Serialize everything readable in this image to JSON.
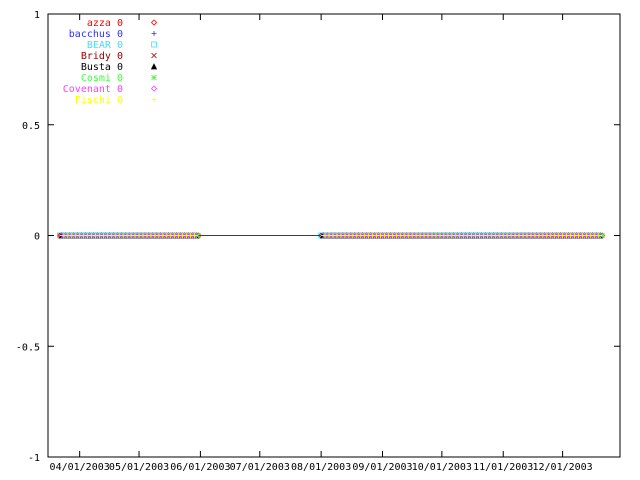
{
  "chart_data": {
    "type": "line",
    "title": "",
    "xlabel": "",
    "ylabel": "",
    "ylim": [
      -1,
      1
    ],
    "xlim": [
      "2003-03-16",
      "2003-12-30"
    ],
    "grid": false,
    "legend_position": "top-left",
    "y_ticks": [
      {
        "value": 1,
        "label": "1"
      },
      {
        "value": 0.5,
        "label": "0.5"
      },
      {
        "value": 0,
        "label": "0"
      },
      {
        "value": -0.5,
        "label": "-0.5"
      },
      {
        "value": -1,
        "label": "-1"
      }
    ],
    "x_ticks": [
      {
        "value": "2003-04-01",
        "label": "04/01/2003"
      },
      {
        "value": "2003-05-01",
        "label": "05/01/2003"
      },
      {
        "value": "2003-06-01",
        "label": "06/01/2003"
      },
      {
        "value": "2003-07-01",
        "label": "07/01/2003"
      },
      {
        "value": "2003-08-01",
        "label": "08/01/2003"
      },
      {
        "value": "2003-09-01",
        "label": "09/01/2003"
      },
      {
        "value": "2003-10-01",
        "label": "10/01/2003"
      },
      {
        "value": "2003-11-01",
        "label": "11/01/2003"
      },
      {
        "value": "2003-12-01",
        "label": "12/01/2003"
      }
    ],
    "series": [
      {
        "name": "azza",
        "legend_value": "0",
        "color": "#ff0000",
        "marker": "diamond",
        "ranges": [
          [
            "2003-03-22",
            "2003-05-31"
          ],
          [
            "2003-08-01",
            "2003-12-21"
          ]
        ],
        "value": 0
      },
      {
        "name": "bacchus",
        "legend_value": "0",
        "color": "#3030ff",
        "marker": "plus",
        "ranges": [
          [
            "2003-03-22",
            "2003-05-31"
          ],
          [
            "2003-08-01",
            "2003-12-21"
          ]
        ],
        "value": 0
      },
      {
        "name": "BEAR",
        "legend_value": "0",
        "color": "#40e0ff",
        "marker": "square",
        "ranges": [
          [
            "2003-03-22",
            "2003-05-31"
          ],
          [
            "2003-08-01",
            "2003-12-21"
          ]
        ],
        "value": 0
      },
      {
        "name": "Bridy",
        "legend_value": "0",
        "color": "#a00000",
        "marker": "x",
        "ranges": [
          [
            "2003-03-22",
            "2003-05-31"
          ],
          [
            "2003-08-01",
            "2003-12-21"
          ]
        ],
        "value": 0
      },
      {
        "name": "Busta",
        "legend_value": "0",
        "color": "#000000",
        "marker": "triangle",
        "ranges": [
          [
            "2003-03-22",
            "2003-05-31"
          ],
          [
            "2003-08-01",
            "2003-12-21"
          ]
        ],
        "value": 0
      },
      {
        "name": "Cosmi",
        "legend_value": "0",
        "color": "#40ff40",
        "marker": "star",
        "ranges": [
          [
            "2003-03-22",
            "2003-05-31"
          ],
          [
            "2003-08-01",
            "2003-12-21"
          ]
        ],
        "value": 0
      },
      {
        "name": "Covenant",
        "legend_value": "0",
        "color": "#ff40ff",
        "marker": "diamond",
        "ranges": [
          [
            "2003-03-22",
            "2003-05-31"
          ],
          [
            "2003-08-01",
            "2003-12-21"
          ]
        ],
        "value": 0
      },
      {
        "name": "Fischi",
        "legend_value": "0",
        "color": "#ffff00",
        "marker": "plus",
        "ranges": [
          [
            "2003-03-22",
            "2003-05-31"
          ],
          [
            "2003-08-01",
            "2003-12-21"
          ]
        ],
        "value": 0
      }
    ]
  }
}
